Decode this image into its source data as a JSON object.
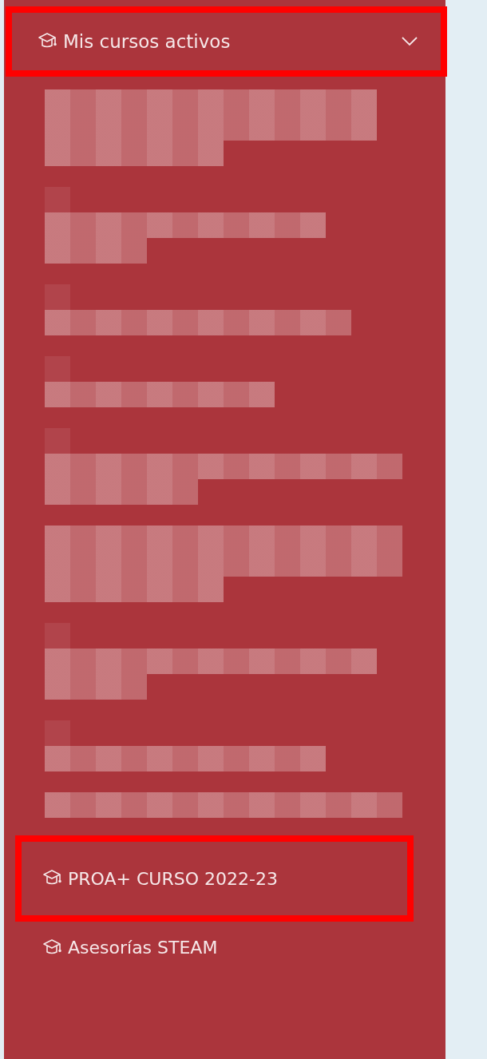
{
  "sidebar": {
    "header": {
      "label": "Mis cursos activos",
      "expanded": true,
      "highlighted": true
    },
    "hidden_items": [
      {
        "kind": "pixelated"
      },
      {
        "kind": "pixelated"
      },
      {
        "kind": "pixelated"
      },
      {
        "kind": "pixelated"
      },
      {
        "kind": "pixelated"
      },
      {
        "kind": "pixelated"
      },
      {
        "kind": "pixelated"
      },
      {
        "kind": "pixelated"
      },
      {
        "kind": "pixelated"
      }
    ],
    "items": [
      {
        "label": "PROA+ CURSO 2022-23",
        "highlighted": true
      },
      {
        "label": "Asesorías STEAM",
        "highlighted": false
      }
    ]
  }
}
